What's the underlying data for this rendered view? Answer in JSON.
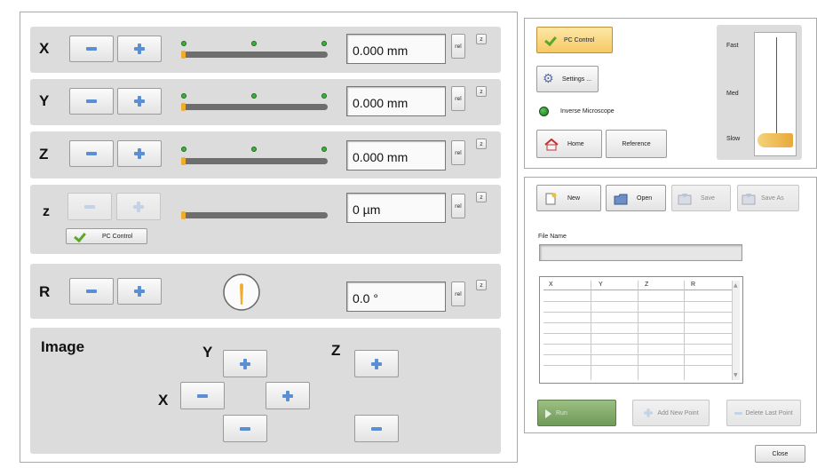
{
  "axes": [
    {
      "label": "X",
      "value": "0.000 mm",
      "rel": "rel",
      "z": "z",
      "slider_level": 0
    },
    {
      "label": "Y",
      "value": "0.000 mm",
      "rel": "rel",
      "z": "z",
      "slider_level": 0
    },
    {
      "label": "Z",
      "value": "0.000 mm",
      "rel": "rel",
      "z": "z",
      "slider_level": 0
    },
    {
      "label": "z",
      "value": "0 µm",
      "rel": "rel",
      "z": "z",
      "slider_level": 0,
      "pc_control_label": "PC Control"
    },
    {
      "label": "R",
      "value": "0.0 °",
      "rel": "rel",
      "z": "z"
    }
  ],
  "image_panel": {
    "title": "Image",
    "y_label": "Y",
    "x_label": "X",
    "z_label": "Z"
  },
  "control": {
    "pc_control": "PC Control",
    "settings": "Settings ...",
    "inverse_microscope": "Inverse Microscope",
    "home": "Home",
    "reference": "Reference",
    "speed": {
      "fast": "Fast",
      "med": "Med",
      "slow": "Slow",
      "level": "slow"
    }
  },
  "points": {
    "new": "New",
    "open": "Open",
    "save": "Save",
    "save_as": "Save As",
    "file_name_label": "File Name",
    "file_name_value": "",
    "columns": [
      "X",
      "Y",
      "Z",
      "R"
    ],
    "run": "Run",
    "add_point": "Add New Point",
    "delete_point": "Delete Last Point"
  },
  "close": "Close",
  "colors": {
    "accent_orange": "#f0ad2c",
    "plus_blue": "#5b8fd3",
    "indicator_green": "#2f8f2f"
  }
}
